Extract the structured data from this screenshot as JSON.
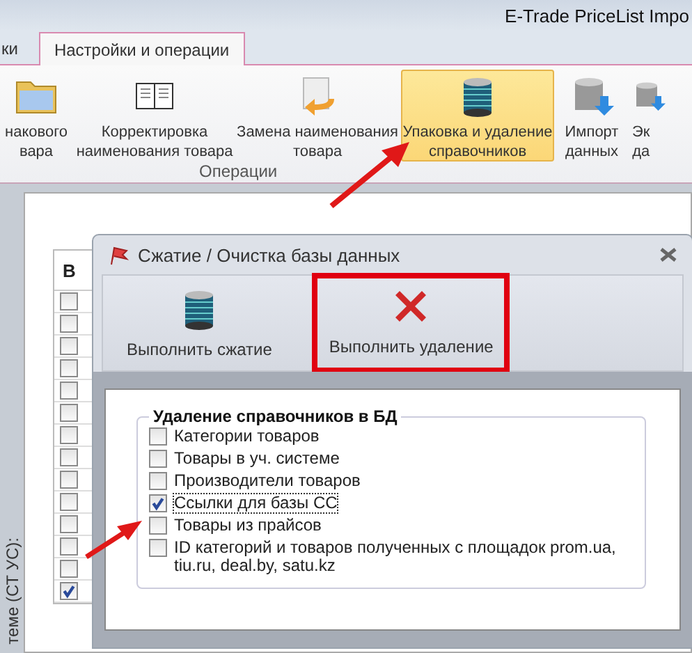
{
  "window": {
    "title": "E-Trade PriceList Impo"
  },
  "tabs": [
    {
      "label": "ки",
      "selected": false
    },
    {
      "label": "Настройки и операции",
      "selected": true
    }
  ],
  "ribbon": {
    "buttons": [
      {
        "label": "накового\nвара",
        "selected": false
      },
      {
        "label": "Корректировка\nнаименования товара",
        "selected": false
      },
      {
        "label": "Замена наименования\nтовара",
        "selected": false
      },
      {
        "label": "Упаковка и удаление\nсправочников",
        "selected": true
      },
      {
        "label": "Импорт\nданных",
        "selected": false
      },
      {
        "label": "Эк\nда",
        "selected": false
      }
    ],
    "group_label": "Операции"
  },
  "side_label": "теме (СТ УС):",
  "grid": {
    "header": "В",
    "rows": [
      {
        "checked": false
      },
      {
        "checked": false
      },
      {
        "checked": false
      },
      {
        "checked": false
      },
      {
        "checked": false
      },
      {
        "checked": false
      },
      {
        "checked": false
      },
      {
        "checked": false
      },
      {
        "checked": false
      },
      {
        "checked": false
      },
      {
        "checked": false
      },
      {
        "checked": false
      },
      {
        "checked": false
      },
      {
        "checked": true
      }
    ]
  },
  "dialog": {
    "title": "Сжатие / Очистка базы данных",
    "toolbar": [
      {
        "label": "Выполнить сжатие",
        "highlighted": false
      },
      {
        "label": "Выполнить удаление",
        "highlighted": true
      }
    ],
    "group": {
      "title": "Удаление справочников в БД",
      "items": [
        {
          "label": "Категории товаров",
          "checked": false,
          "focused": false
        },
        {
          "label": "Товары в уч. системе",
          "checked": false,
          "focused": false
        },
        {
          "label": "Производители товаров",
          "checked": false,
          "focused": false
        },
        {
          "label": "Ссылки для базы СС",
          "checked": true,
          "focused": true
        },
        {
          "label": "Товары из прайсов",
          "checked": false,
          "focused": false
        },
        {
          "label": "ID категорий и товаров полученных с площадок prom.ua, tiu.ru, deal.by, satu.kz",
          "checked": false,
          "focused": false
        }
      ]
    }
  }
}
